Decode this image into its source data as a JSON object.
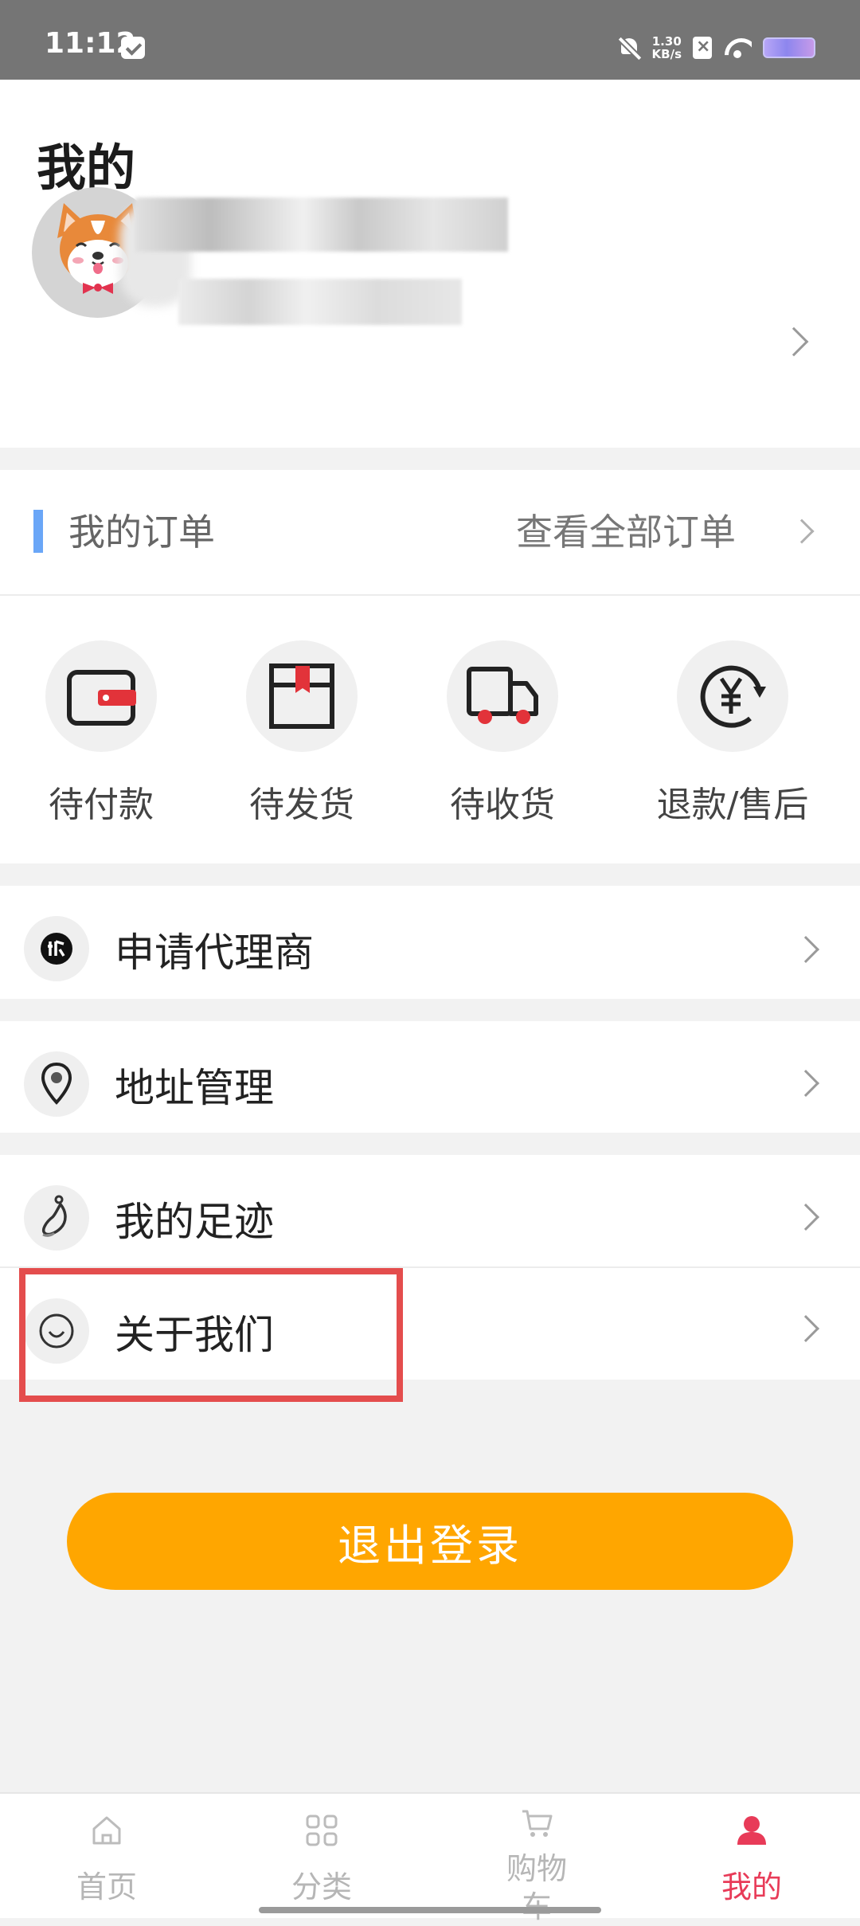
{
  "status_bar": {
    "time": "11:12",
    "net_speed_value": "1.30",
    "net_speed_unit": "KB/s"
  },
  "page": {
    "title": "我的"
  },
  "orders": {
    "title": "我的订单",
    "view_all": "查看全部订单",
    "statuses": [
      {
        "label": "待付款",
        "icon": "wallet-icon"
      },
      {
        "label": "待发货",
        "icon": "box-icon"
      },
      {
        "label": "待收货",
        "icon": "truck-icon"
      },
      {
        "label": "退款/售后",
        "icon": "yen-refund-icon"
      }
    ]
  },
  "menu": {
    "items": [
      {
        "label": "申请代理商",
        "icon": "agent-icon"
      },
      {
        "label": "地址管理",
        "icon": "location-pin-icon"
      },
      {
        "label": "我的足迹",
        "icon": "footprint-icon"
      },
      {
        "label": "关于我们",
        "icon": "smile-icon"
      }
    ]
  },
  "logout": {
    "label": "退出登录"
  },
  "bottom_nav": {
    "items": [
      {
        "label": "首页",
        "icon": "home-icon"
      },
      {
        "label": "分类",
        "icon": "grid-icon"
      },
      {
        "label": "购物车",
        "icon": "cart-icon"
      },
      {
        "label": "我的",
        "icon": "person-icon"
      }
    ],
    "active_index": 3
  },
  "colors": {
    "accent": "#ffa600",
    "active_tab": "#e83b58",
    "highlight": "#e44d4d",
    "order_accent": "#6aa6f7"
  }
}
